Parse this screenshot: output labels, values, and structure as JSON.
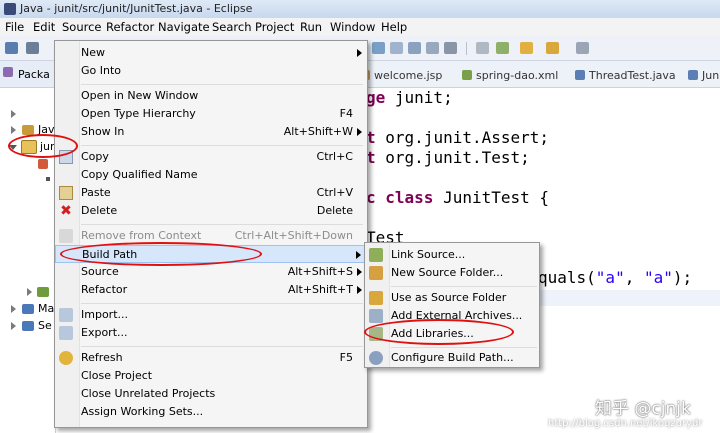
{
  "window": {
    "title": "Java - junit/src/junit/JunitTest.java - Eclipse"
  },
  "menubar": [
    "File",
    "Edit",
    "Source",
    "Refactor",
    "Navigate",
    "Search",
    "Project",
    "Run",
    "Window",
    "Help"
  ],
  "explorer": {
    "tab_label": "Packa",
    "rows": [
      "Jav",
      "juni",
      "Ma",
      "Se"
    ]
  },
  "editor": {
    "tabs": [
      "welcome.jsp",
      "spring-dao.xml",
      "ThreadTest.java",
      "Jun"
    ],
    "code": {
      "l1_kw": "ge",
      "l1_rest": " junit;",
      "l2_kw": "t",
      "l2_rest": " org.junit.Assert;",
      "l3_kw": "t",
      "l3_rest": " org.junit.Test;",
      "l4_kw": "c class",
      "l4_rest": " JunitTest {",
      "l5": "Test",
      "l6_pre": "quals(",
      "l6_s1": "\"a\"",
      "l6_mid": ", ",
      "l6_s2": "\"a\"",
      "l6_post": ");"
    }
  },
  "context_menu": {
    "items": {
      "new": {
        "label": "New"
      },
      "go_into": {
        "label": "Go Into"
      },
      "open_new_window": {
        "label": "Open in New Window"
      },
      "open_type_hierarchy": {
        "label": "Open Type Hierarchy",
        "shortcut": "F4"
      },
      "show_in": {
        "label": "Show In",
        "shortcut": "Alt+Shift+W"
      },
      "copy": {
        "label": "Copy",
        "shortcut": "Ctrl+C"
      },
      "copy_qualified": {
        "label": "Copy Qualified Name"
      },
      "paste": {
        "label": "Paste",
        "shortcut": "Ctrl+V"
      },
      "delete": {
        "label": "Delete",
        "shortcut": "Delete"
      },
      "remove_context": {
        "label": "Remove from Context",
        "shortcut": "Ctrl+Alt+Shift+Down"
      },
      "build_path": {
        "label": "Build Path"
      },
      "source": {
        "label": "Source",
        "shortcut": "Alt+Shift+S"
      },
      "refactor": {
        "label": "Refactor",
        "shortcut": "Alt+Shift+T"
      },
      "import": {
        "label": "Import..."
      },
      "export": {
        "label": "Export..."
      },
      "refresh": {
        "label": "Refresh",
        "shortcut": "F5"
      },
      "close_project": {
        "label": "Close Project"
      },
      "close_unrelated": {
        "label": "Close Unrelated Projects"
      },
      "assign_working_sets": {
        "label": "Assign Working Sets..."
      }
    }
  },
  "submenu": {
    "items": {
      "link_source": {
        "label": "Link Source..."
      },
      "new_source_folder": {
        "label": "New Source Folder..."
      },
      "use_as_source": {
        "label": "Use as Source Folder"
      },
      "add_external_archives": {
        "label": "Add External Archives..."
      },
      "add_libraries": {
        "label": "Add Libraries..."
      },
      "configure_build_path": {
        "label": "Configure Build Path..."
      }
    }
  },
  "watermark": {
    "text": "知乎 @cjnjk",
    "url": "http://blog.csdn.net/ikoqzurydr"
  }
}
